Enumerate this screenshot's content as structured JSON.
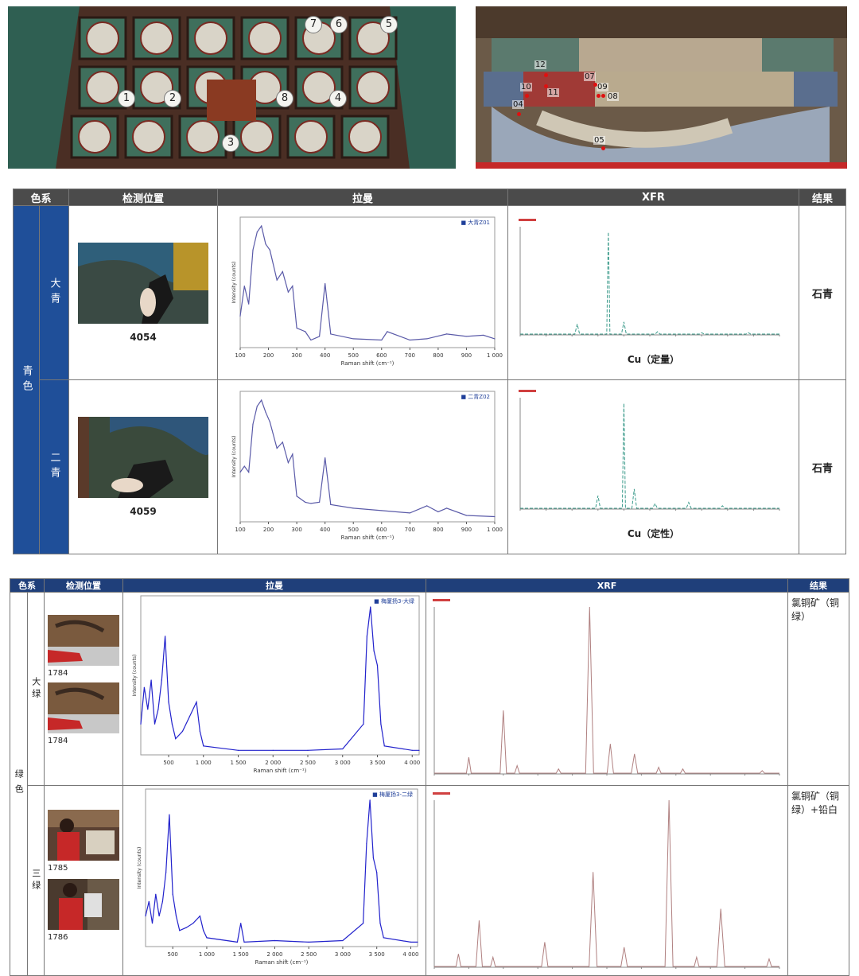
{
  "photos": {
    "ceiling_markers": [
      "1",
      "2",
      "3",
      "4",
      "5",
      "6",
      "7",
      "8"
    ],
    "beam_markers": [
      "12",
      "10",
      "11",
      "04",
      "07",
      "09",
      "08",
      "05"
    ]
  },
  "table1": {
    "headers": {
      "group": "色系",
      "position": "检测位置",
      "raman": "拉曼",
      "xrf": "XFR",
      "result": "结果"
    },
    "group_label": "青色",
    "rows": [
      {
        "sub": "大青",
        "sample": "4054",
        "legend": "大青Z01",
        "xrf_caption": "Cu（定量）",
        "result": "石青"
      },
      {
        "sub": "二青",
        "sample": "4059",
        "legend": "二青Z02",
        "xrf_caption": "Cu（定性）",
        "result": "石青"
      }
    ],
    "raman_axis": {
      "xlabel": "Raman shift (cm⁻¹)",
      "ylabel": "Intensity (counts)",
      "ticks": [
        "100",
        "200",
        "300",
        "400",
        "500",
        "600",
        "700",
        "800",
        "900",
        "1 000"
      ]
    }
  },
  "table2": {
    "headers": {
      "group": "色系",
      "position": "检测位置",
      "raman": "拉曼",
      "xrf": "XRF",
      "result": "结果"
    },
    "group_label": "绿色",
    "rows": [
      {
        "sub": "大绿",
        "samples": [
          "1784",
          "1784"
        ],
        "legend": "梅厦扬3-大绿",
        "result": "氯铜矿（铜绿）"
      },
      {
        "sub": "三绿",
        "samples": [
          "1785",
          "1786"
        ],
        "legend": "梅厦扬3-二绿",
        "result": "氯铜矿（铜绿）+铅白"
      }
    ],
    "raman_axis": {
      "xlabel": "Raman shift (cm⁻¹)",
      "ylabel": "Intensity (counts)",
      "ticks": [
        "500",
        "1 000",
        "1 500",
        "2 000",
        "2 500",
        "3 000",
        "3 500",
        "4 000"
      ]
    }
  },
  "chart_data": [
    {
      "type": "line",
      "legend": "大青Z01",
      "xlabel": "Raman shift (cm⁻¹)",
      "ylabel": "Intensity (counts)",
      "xlim": [
        100,
        1000
      ],
      "x": [
        100,
        115,
        130,
        145,
        160,
        175,
        190,
        205,
        230,
        250,
        270,
        285,
        300,
        330,
        350,
        380,
        400,
        420,
        500,
        600,
        620,
        700,
        760,
        830,
        900,
        960,
        1000
      ],
      "y": [
        0.25,
        0.5,
        0.35,
        0.8,
        0.95,
        1.0,
        0.85,
        0.8,
        0.55,
        0.62,
        0.45,
        0.5,
        0.15,
        0.12,
        0.05,
        0.08,
        0.52,
        0.1,
        0.06,
        0.05,
        0.12,
        0.05,
        0.06,
        0.1,
        0.08,
        0.09,
        0.06
      ]
    },
    {
      "type": "line",
      "legend": "二青Z02",
      "xlabel": "Raman shift (cm⁻¹)",
      "ylabel": "Intensity (counts)",
      "xlim": [
        100,
        1000
      ],
      "x": [
        100,
        115,
        130,
        145,
        160,
        175,
        190,
        205,
        230,
        250,
        270,
        285,
        300,
        330,
        350,
        380,
        400,
        420,
        500,
        600,
        700,
        760,
        800,
        830,
        900,
        1000
      ],
      "y": [
        0.4,
        0.45,
        0.4,
        0.8,
        0.95,
        1.0,
        0.9,
        0.82,
        0.6,
        0.65,
        0.48,
        0.55,
        0.2,
        0.15,
        0.14,
        0.15,
        0.52,
        0.13,
        0.1,
        0.08,
        0.06,
        0.12,
        0.07,
        0.1,
        0.04,
        0.03
      ]
    },
    {
      "type": "line",
      "legend": "梅厦扬3-大绿",
      "xlabel": "Raman shift (cm⁻¹)",
      "ylabel": "Intensity (counts)",
      "xlim": [
        100,
        4100
      ],
      "x": [
        100,
        150,
        200,
        250,
        300,
        350,
        400,
        450,
        500,
        550,
        600,
        700,
        800,
        900,
        950,
        1000,
        1500,
        2000,
        2500,
        3000,
        3300,
        3350,
        3400,
        3450,
        3500,
        3550,
        3600,
        4000,
        4100
      ],
      "y": [
        0.2,
        0.45,
        0.3,
        0.5,
        0.2,
        0.3,
        0.5,
        0.8,
        0.35,
        0.2,
        0.1,
        0.15,
        0.25,
        0.35,
        0.15,
        0.05,
        0.02,
        0.02,
        0.02,
        0.03,
        0.2,
        0.8,
        1.0,
        0.7,
        0.6,
        0.2,
        0.05,
        0.02,
        0.02
      ]
    },
    {
      "type": "line",
      "legend": "梅厦扬3-二绿",
      "xlabel": "Raman shift (cm⁻¹)",
      "ylabel": "Intensity (counts)",
      "xlim": [
        100,
        4100
      ],
      "x": [
        100,
        150,
        200,
        250,
        300,
        350,
        400,
        450,
        500,
        550,
        600,
        700,
        800,
        900,
        950,
        1000,
        1450,
        1500,
        1550,
        2000,
        2500,
        3000,
        3300,
        3350,
        3400,
        3450,
        3500,
        3550,
        3600,
        4000,
        4100
      ],
      "y": [
        0.2,
        0.3,
        0.15,
        0.35,
        0.2,
        0.3,
        0.5,
        0.9,
        0.35,
        0.2,
        0.1,
        0.12,
        0.15,
        0.2,
        0.1,
        0.05,
        0.02,
        0.15,
        0.02,
        0.03,
        0.02,
        0.03,
        0.15,
        0.7,
        1.0,
        0.6,
        0.5,
        0.15,
        0.05,
        0.02,
        0.02
      ]
    }
  ]
}
